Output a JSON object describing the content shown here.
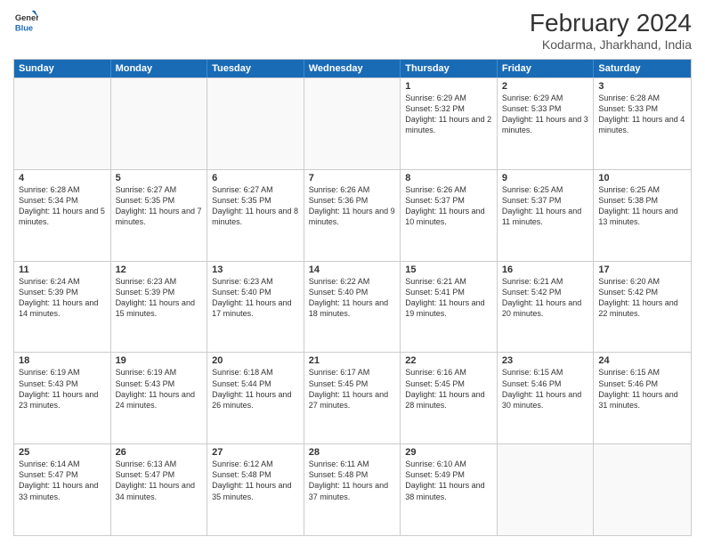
{
  "header": {
    "logo_general": "General",
    "logo_blue": "Blue",
    "main_title": "February 2024",
    "subtitle": "Kodarma, Jharkhand, India"
  },
  "days": [
    "Sunday",
    "Monday",
    "Tuesday",
    "Wednesday",
    "Thursday",
    "Friday",
    "Saturday"
  ],
  "weeks": [
    [
      {
        "num": "",
        "text": "",
        "empty": true
      },
      {
        "num": "",
        "text": "",
        "empty": true
      },
      {
        "num": "",
        "text": "",
        "empty": true
      },
      {
        "num": "",
        "text": "",
        "empty": true
      },
      {
        "num": "1",
        "text": "Sunrise: 6:29 AM\nSunset: 5:32 PM\nDaylight: 11 hours and 2 minutes.",
        "empty": false
      },
      {
        "num": "2",
        "text": "Sunrise: 6:29 AM\nSunset: 5:33 PM\nDaylight: 11 hours and 3 minutes.",
        "empty": false
      },
      {
        "num": "3",
        "text": "Sunrise: 6:28 AM\nSunset: 5:33 PM\nDaylight: 11 hours and 4 minutes.",
        "empty": false
      }
    ],
    [
      {
        "num": "4",
        "text": "Sunrise: 6:28 AM\nSunset: 5:34 PM\nDaylight: 11 hours and 5 minutes.",
        "empty": false
      },
      {
        "num": "5",
        "text": "Sunrise: 6:27 AM\nSunset: 5:35 PM\nDaylight: 11 hours and 7 minutes.",
        "empty": false
      },
      {
        "num": "6",
        "text": "Sunrise: 6:27 AM\nSunset: 5:35 PM\nDaylight: 11 hours and 8 minutes.",
        "empty": false
      },
      {
        "num": "7",
        "text": "Sunrise: 6:26 AM\nSunset: 5:36 PM\nDaylight: 11 hours and 9 minutes.",
        "empty": false
      },
      {
        "num": "8",
        "text": "Sunrise: 6:26 AM\nSunset: 5:37 PM\nDaylight: 11 hours and 10 minutes.",
        "empty": false
      },
      {
        "num": "9",
        "text": "Sunrise: 6:25 AM\nSunset: 5:37 PM\nDaylight: 11 hours and 11 minutes.",
        "empty": false
      },
      {
        "num": "10",
        "text": "Sunrise: 6:25 AM\nSunset: 5:38 PM\nDaylight: 11 hours and 13 minutes.",
        "empty": false
      }
    ],
    [
      {
        "num": "11",
        "text": "Sunrise: 6:24 AM\nSunset: 5:39 PM\nDaylight: 11 hours and 14 minutes.",
        "empty": false
      },
      {
        "num": "12",
        "text": "Sunrise: 6:23 AM\nSunset: 5:39 PM\nDaylight: 11 hours and 15 minutes.",
        "empty": false
      },
      {
        "num": "13",
        "text": "Sunrise: 6:23 AM\nSunset: 5:40 PM\nDaylight: 11 hours and 17 minutes.",
        "empty": false
      },
      {
        "num": "14",
        "text": "Sunrise: 6:22 AM\nSunset: 5:40 PM\nDaylight: 11 hours and 18 minutes.",
        "empty": false
      },
      {
        "num": "15",
        "text": "Sunrise: 6:21 AM\nSunset: 5:41 PM\nDaylight: 11 hours and 19 minutes.",
        "empty": false
      },
      {
        "num": "16",
        "text": "Sunrise: 6:21 AM\nSunset: 5:42 PM\nDaylight: 11 hours and 20 minutes.",
        "empty": false
      },
      {
        "num": "17",
        "text": "Sunrise: 6:20 AM\nSunset: 5:42 PM\nDaylight: 11 hours and 22 minutes.",
        "empty": false
      }
    ],
    [
      {
        "num": "18",
        "text": "Sunrise: 6:19 AM\nSunset: 5:43 PM\nDaylight: 11 hours and 23 minutes.",
        "empty": false
      },
      {
        "num": "19",
        "text": "Sunrise: 6:19 AM\nSunset: 5:43 PM\nDaylight: 11 hours and 24 minutes.",
        "empty": false
      },
      {
        "num": "20",
        "text": "Sunrise: 6:18 AM\nSunset: 5:44 PM\nDaylight: 11 hours and 26 minutes.",
        "empty": false
      },
      {
        "num": "21",
        "text": "Sunrise: 6:17 AM\nSunset: 5:45 PM\nDaylight: 11 hours and 27 minutes.",
        "empty": false
      },
      {
        "num": "22",
        "text": "Sunrise: 6:16 AM\nSunset: 5:45 PM\nDaylight: 11 hours and 28 minutes.",
        "empty": false
      },
      {
        "num": "23",
        "text": "Sunrise: 6:15 AM\nSunset: 5:46 PM\nDaylight: 11 hours and 30 minutes.",
        "empty": false
      },
      {
        "num": "24",
        "text": "Sunrise: 6:15 AM\nSunset: 5:46 PM\nDaylight: 11 hours and 31 minutes.",
        "empty": false
      }
    ],
    [
      {
        "num": "25",
        "text": "Sunrise: 6:14 AM\nSunset: 5:47 PM\nDaylight: 11 hours and 33 minutes.",
        "empty": false
      },
      {
        "num": "26",
        "text": "Sunrise: 6:13 AM\nSunset: 5:47 PM\nDaylight: 11 hours and 34 minutes.",
        "empty": false
      },
      {
        "num": "27",
        "text": "Sunrise: 6:12 AM\nSunset: 5:48 PM\nDaylight: 11 hours and 35 minutes.",
        "empty": false
      },
      {
        "num": "28",
        "text": "Sunrise: 6:11 AM\nSunset: 5:48 PM\nDaylight: 11 hours and 37 minutes.",
        "empty": false
      },
      {
        "num": "29",
        "text": "Sunrise: 6:10 AM\nSunset: 5:49 PM\nDaylight: 11 hours and 38 minutes.",
        "empty": false
      },
      {
        "num": "",
        "text": "",
        "empty": true
      },
      {
        "num": "",
        "text": "",
        "empty": true
      }
    ]
  ]
}
